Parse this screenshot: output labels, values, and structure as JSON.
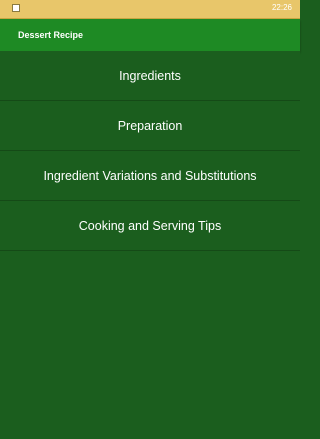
{
  "status_bar": {
    "time": "22:26",
    "icon": "notification-icon"
  },
  "app_bar": {
    "title": "Dessert Recipe"
  },
  "menu": {
    "items": [
      {
        "label": "Ingredients"
      },
      {
        "label": "Preparation"
      },
      {
        "label": "Ingredient Variations and Substitutions"
      },
      {
        "label": "Cooking and Serving Tips"
      }
    ]
  },
  "colors": {
    "status_bar": "#e8c66a",
    "app_bar": "#1e8a24",
    "background": "#1b5e1e",
    "text": "#ffffff"
  }
}
